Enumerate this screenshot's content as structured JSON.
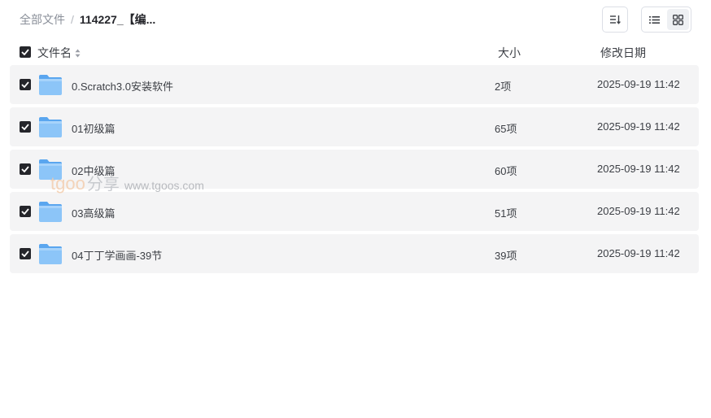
{
  "breadcrumb": {
    "root": "全部文件",
    "separator": "/",
    "current": "114227_【编..."
  },
  "toolbar": {
    "sort_icon": "sort-list-icon",
    "list_view_icon": "list-view-icon",
    "grid_view_icon": "grid-view-icon"
  },
  "columns": {
    "name": "文件名",
    "size": "大小",
    "date": "修改日期"
  },
  "rows": [
    {
      "name": "0.Scratch3.0安装软件",
      "count": "2项",
      "date": "2025-09-19 11:42"
    },
    {
      "name": "01初级篇",
      "count": "65项",
      "date": "2025-09-19 11:42"
    },
    {
      "name": "02中级篇",
      "count": "60项",
      "date": "2025-09-19 11:42"
    },
    {
      "name": "03高级篇",
      "count": "51项",
      "date": "2025-09-19 11:42"
    },
    {
      "name": "04丁丁学画画-39节",
      "count": "39项",
      "date": "2025-09-19 11:42"
    }
  ],
  "watermark": {
    "brand": "tgoo",
    "share": "分享",
    "url": "www.tgoos.com"
  },
  "colors": {
    "checkbox": "#25262b",
    "row_background": "#f4f4f5",
    "folder": "#7dbcf5"
  }
}
